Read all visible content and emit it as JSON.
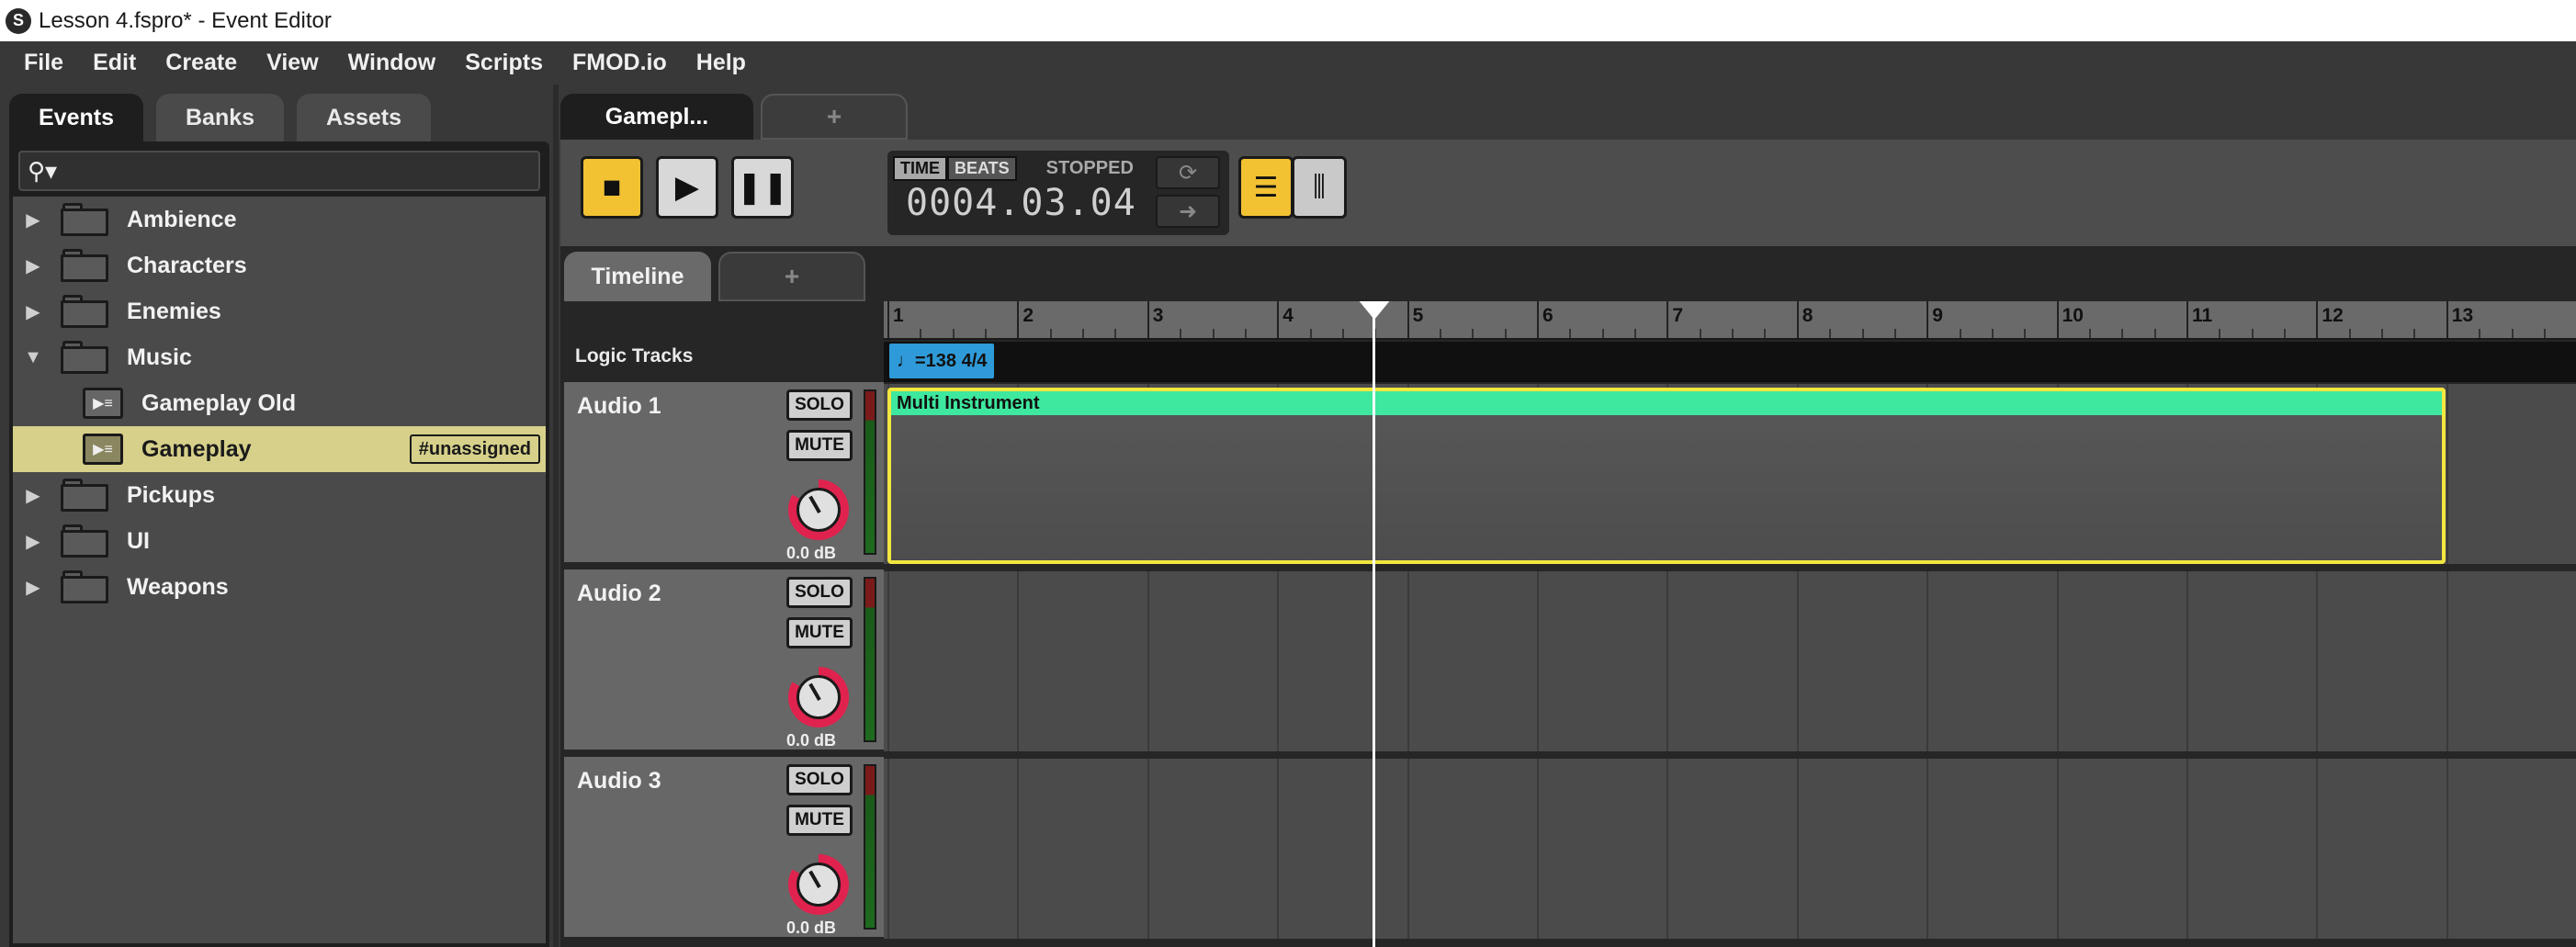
{
  "window": {
    "title": "Lesson 4.fspro* - Event Editor",
    "logo": "S"
  },
  "menu": [
    "File",
    "Edit",
    "Create",
    "View",
    "Window",
    "Scripts",
    "FMOD.io",
    "Help"
  ],
  "browser": {
    "tabs": [
      "Events",
      "Banks",
      "Assets"
    ],
    "search_icon": "⚲▾",
    "items": [
      {
        "label": "Ambience",
        "type": "folder",
        "expanded": false
      },
      {
        "label": "Characters",
        "type": "folder",
        "expanded": false
      },
      {
        "label": "Enemies",
        "type": "folder",
        "expanded": false
      },
      {
        "label": "Music",
        "type": "folder",
        "expanded": true
      },
      {
        "label": "Gameplay Old",
        "type": "event"
      },
      {
        "label": "Gameplay",
        "type": "event",
        "selected": true,
        "badge": "#unassigned"
      },
      {
        "label": "Pickups",
        "type": "folder",
        "expanded": false
      },
      {
        "label": "UI",
        "type": "folder",
        "expanded": false
      },
      {
        "label": "Weapons",
        "type": "folder",
        "expanded": false
      }
    ]
  },
  "editor": {
    "doc_tab": "Gamepl...",
    "add_tab": "+",
    "transport": {
      "time_btn": "TIME",
      "beats_btn": "BEATS",
      "status": "STOPPED",
      "time": "0004.03.04"
    },
    "lower_tab": "Timeline",
    "lower_add": "+",
    "logic_tracks_label": "Logic Tracks",
    "tempo_marker": "=138 4/4",
    "ruler": [
      "1",
      "2",
      "3",
      "4",
      "5",
      "6",
      "7",
      "8",
      "9",
      "10",
      "11",
      "12",
      "13"
    ],
    "tracks": [
      {
        "name": "Audio 1",
        "solo": "SOLO",
        "mute": "MUTE",
        "volume": "0.0 dB"
      },
      {
        "name": "Audio 2",
        "solo": "SOLO",
        "mute": "MUTE",
        "volume": "0.0 dB"
      },
      {
        "name": "Audio 3",
        "solo": "SOLO",
        "mute": "MUTE",
        "volume": "0.0 dB"
      }
    ],
    "instrument_label": "Multi Instrument"
  }
}
